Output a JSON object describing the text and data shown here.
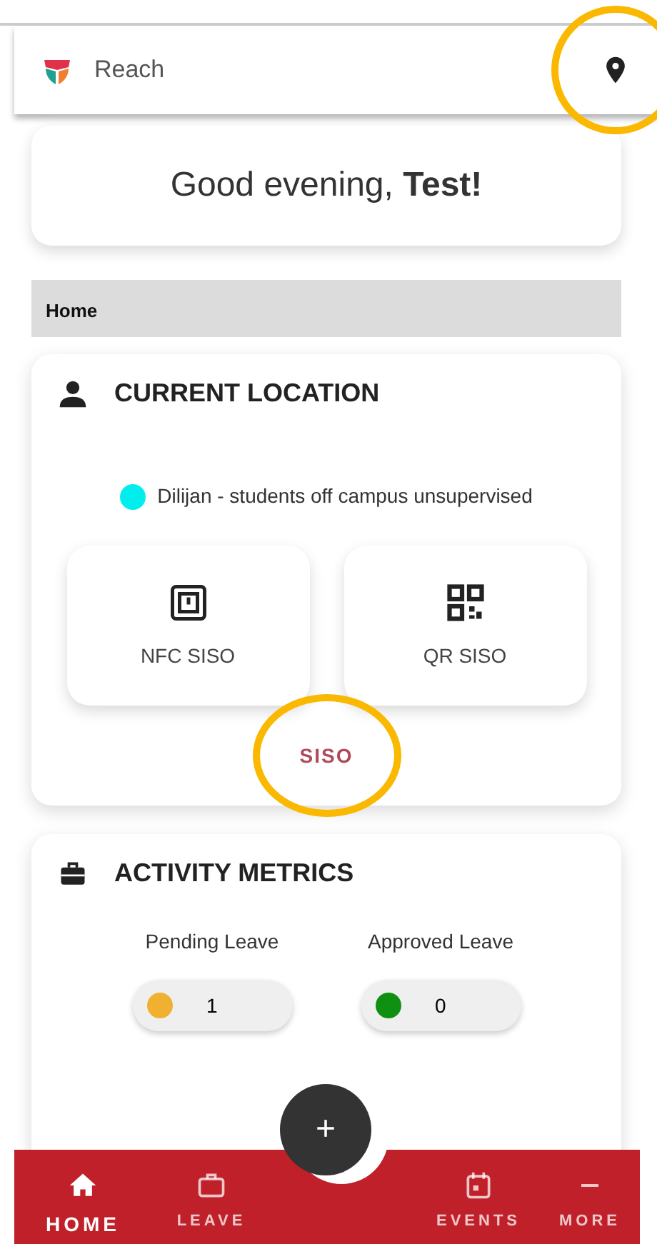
{
  "app_bar": {
    "title": "Reach",
    "location_button_highlighted": true
  },
  "greeting": "Good evening, **Test!**",
  "breadcrumb": "Home",
  "current_location": {
    "title": "CURRENT LOCATION",
    "status": {
      "text": "Dilijan - students off campus unsupervised",
      "color": "#00eeee"
    },
    "actions": [
      {
        "kind": "nfc",
        "label": "NFC SISO"
      },
      {
        "kind": "qr",
        "label": "QR SISO"
      }
    ],
    "link": {
      "label": "SISO",
      "highlighted": true
    }
  },
  "activity_metrics": {
    "title": "ACTIVITY METRICS",
    "metrics": [
      {
        "label": "Pending Leave",
        "value": "1",
        "color": "#f0b030"
      },
      {
        "label": "Approved Leave",
        "value": "0",
        "color": "#109010"
      }
    ]
  },
  "fab": {
    "label": "+"
  },
  "bottom_nav": [
    {
      "kind": "home",
      "label": "HOME",
      "selected": true
    },
    {
      "kind": "leave",
      "label": "LEAVE",
      "selected": false
    },
    {
      "kind": "events",
      "label": "EVENTS",
      "selected": false
    },
    {
      "kind": "more",
      "label": "MORE",
      "selected": false
    }
  ]
}
